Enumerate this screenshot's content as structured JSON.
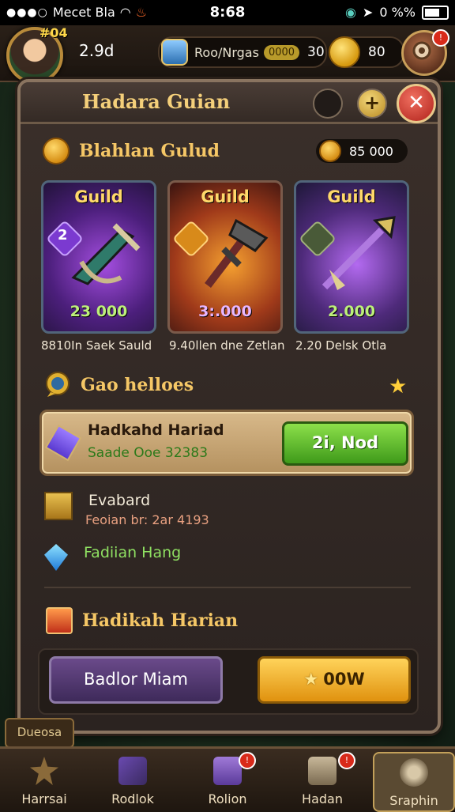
{
  "statusbar": {
    "carrier": "Mecet Bla",
    "time": "8:68",
    "indicators": "0 %%"
  },
  "topbar": {
    "level": "#04",
    "gold": "2.9d",
    "resource_label": "Roo/Nrgas",
    "resource_chip": "0000",
    "resource_value": "30",
    "gem_value": "80"
  },
  "modal": {
    "title": "Hadara Guian",
    "plus": "+",
    "close": "✕",
    "section1_title": "Blahlan Gulud",
    "balance": "85 000",
    "cards": [
      {
        "title": "Guild",
        "badge": "2",
        "value": "23 000",
        "caption": "8810In Saek Sauld"
      },
      {
        "title": "Guild",
        "badge": "",
        "value": "3:.000",
        "caption": "9.40llen dne Zetlan"
      },
      {
        "title": "Guild",
        "badge": "",
        "value": "2.000",
        "caption": "2.20 Delsk Otla"
      }
    ],
    "section2_title": "Gao helloes",
    "reward": {
      "title": "Hadkahd Hariad",
      "subtitle": "Saade Ooe 32383",
      "button": "2i, Nod"
    },
    "items": [
      {
        "title": "Evabard",
        "subtitle": "Feoian br: 2ar 4193"
      },
      {
        "title": "Fadiian Hang",
        "subtitle": ""
      }
    ],
    "section3_title": "Hadikah Harian",
    "buttons": {
      "secondary": "Badlor Miam",
      "primary": "00W"
    }
  },
  "side_tag": "Dueosa",
  "nav": [
    {
      "label": "Harrsai",
      "active": false,
      "badge": ""
    },
    {
      "label": "Rodlok",
      "active": false,
      "badge": ""
    },
    {
      "label": "Rolion",
      "active": false,
      "badge": "!"
    },
    {
      "label": "Hadan",
      "active": false,
      "badge": "!"
    },
    {
      "label": "Sraphin",
      "active": true,
      "badge": ""
    }
  ],
  "colors": {
    "accent_gold": "#f5c766",
    "claim_green": "#5fbf2a",
    "close_red": "#c8281c",
    "panel": "#2e2622"
  },
  "icons": [
    "wifi-icon",
    "flame-icon",
    "globe-icon",
    "location-icon",
    "battery-icon",
    "shield-icon",
    "gem-icon",
    "settings-icon",
    "coin-icon",
    "sword-icon",
    "axe-icon",
    "spear-icon",
    "chat-icon",
    "star-icon",
    "crate-icon",
    "crystal-icon",
    "cube-icon"
  ]
}
